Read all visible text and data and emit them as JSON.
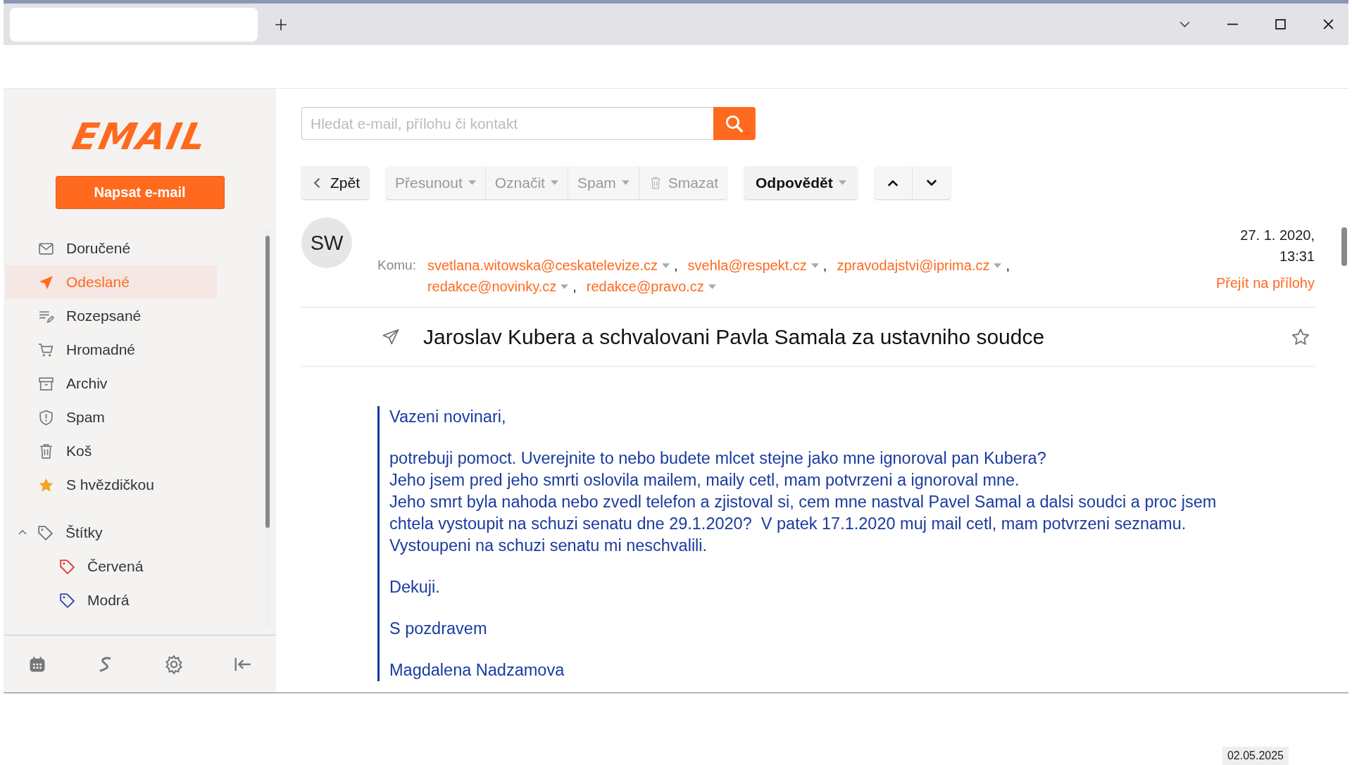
{
  "logo": "EMAIL",
  "compose_button": "Napsat e-mail",
  "folders": [
    {
      "label": "Doručené",
      "kind": "inbox",
      "selected": false
    },
    {
      "label": "Odeslané",
      "kind": "sent",
      "selected": true
    },
    {
      "label": "Rozepsané",
      "kind": "drafts",
      "selected": false
    },
    {
      "label": "Hromadné",
      "kind": "bulk",
      "selected": false
    },
    {
      "label": "Archiv",
      "kind": "archive",
      "selected": false
    },
    {
      "label": "Spam",
      "kind": "spam",
      "selected": false
    },
    {
      "label": "Koš",
      "kind": "trash",
      "selected": false
    },
    {
      "label": "S hvězdičkou",
      "kind": "starred",
      "selected": false
    }
  ],
  "labels_section": {
    "label": "Štítky",
    "expanded": true,
    "items": [
      {
        "label": "Červená",
        "color": "#e53935"
      },
      {
        "label": "Modrá",
        "color": "#3949ab"
      }
    ]
  },
  "search": {
    "placeholder": "Hledat e-mail, přílohu či kontakt"
  },
  "toolbar": [
    {
      "label": "Zpět",
      "kind": "back",
      "disabled": false
    },
    {
      "label": "Přesunout",
      "kind": "dropdown",
      "disabled": true
    },
    {
      "label": "Označit",
      "kind": "dropdown",
      "disabled": true
    },
    {
      "label": "Spam",
      "kind": "dropdown",
      "disabled": true
    },
    {
      "label": "Smazat",
      "kind": "delete",
      "disabled": true
    },
    {
      "label": "Odpovědět",
      "kind": "reply",
      "disabled": false
    }
  ],
  "message": {
    "avatar": "SW",
    "to_label": "Komu:",
    "recipient_rows": [
      [
        {
          "address": "svetlana.witowska@ceskatelevize.cz",
          "separator": ","
        },
        {
          "address": "svehla@respekt.cz",
          "separator": ","
        },
        {
          "address": "zpravodajstvi@iprima.cz",
          "separator": ","
        }
      ],
      [
        {
          "address": "redakce@novinky.cz",
          "separator": ","
        },
        {
          "address": "redakce@pravo.cz"
        }
      ]
    ],
    "date": "27. 1. 2020,",
    "time": "13:31",
    "attachments_link": "Přejít na přílohy",
    "subject": "Jaroslav Kubera a schvalovani Pavla Samala za ustavniho soudce",
    "starred": false,
    "body": [
      [
        "Vazeni novinari,"
      ],
      [
        "potrebuji pomoct. Uverejnite to nebo budete mlcet stejne jako mne ignoroval pan Kubera?",
        "Jeho jsem pred jeho smrti oslovila mailem, maily cetl, mam potvrzeni a ignoroval mne.",
        "Jeho smrt byla nahoda nebo zvedl telefon a zjistoval si, cem mne nastval Pavel Samal a dalsi soudci a proc jsem",
        "chtela vystoupit na schuzi senatu dne 29.1.2020?  V patek 17.1.2020 muj mail cetl, mam potvrzeni seznamu.",
        "Vystoupeni na schuzi senatu mi neschvalili."
      ],
      [
        "Dekuji."
      ],
      [
        "S pozdravem"
      ],
      [
        "Magdalena Nadzamova"
      ]
    ]
  },
  "footer_date": "02.05.2025"
}
